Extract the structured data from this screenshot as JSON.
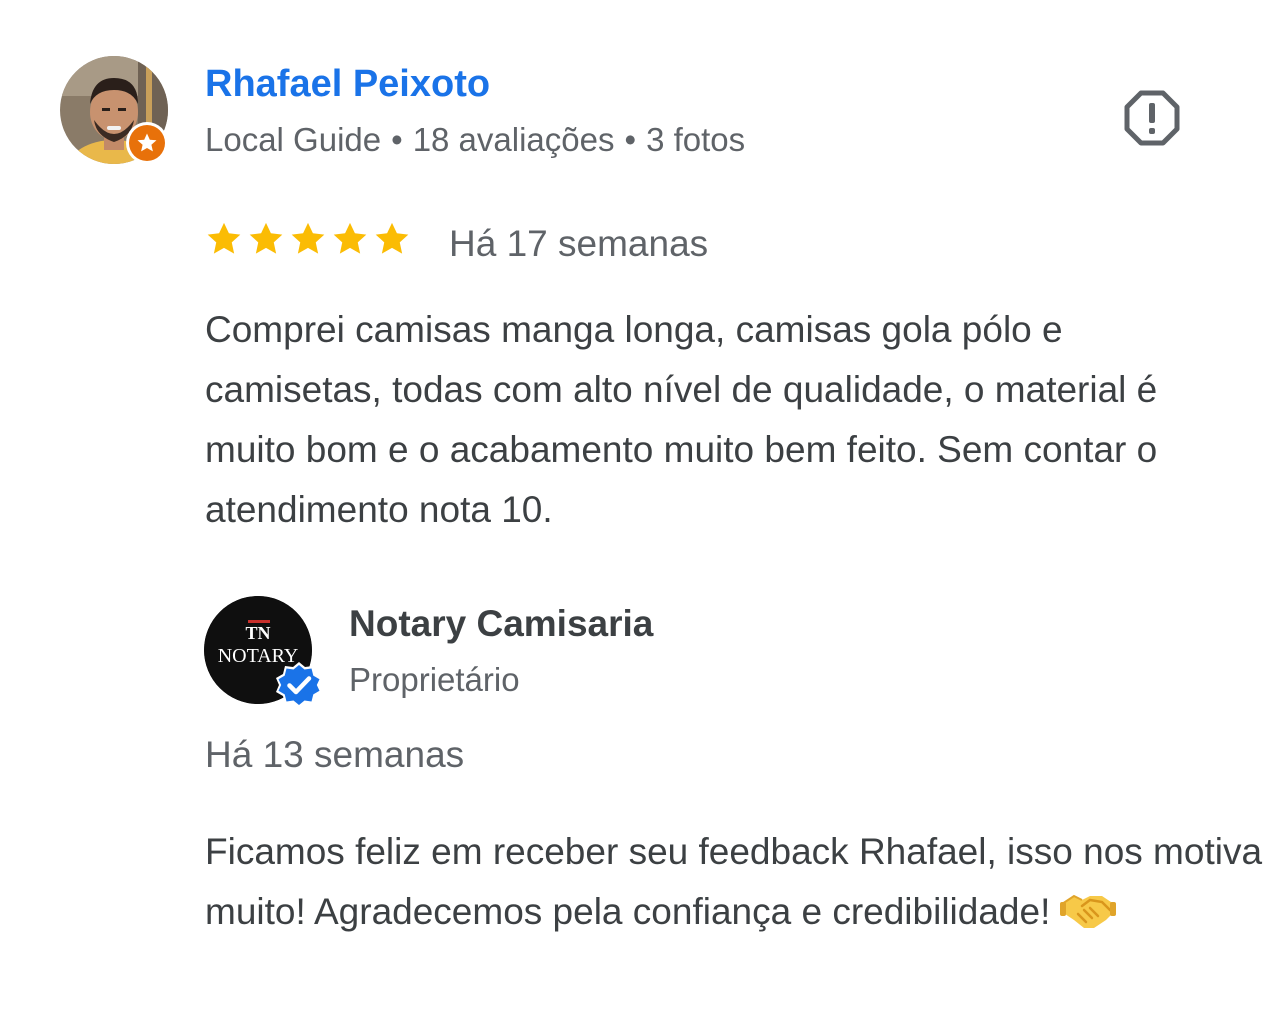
{
  "review": {
    "reviewer": {
      "name": "Rhafael Peixoto",
      "level": "Local Guide",
      "reviews_count": "18 avaliações",
      "photos_count": "3 fotos",
      "separator": "•",
      "badge_icon": "star-icon",
      "badge_color": "#e8710a"
    },
    "report_icon": "report-flag-icon",
    "rating": 5,
    "rating_max": 5,
    "star_color": "#fbbc04",
    "date": "Há 17 semanas",
    "text": "Comprei camisas manga longa, camisas gola pólo e camisetas, todas com alto nível de qualidade, o material é muito bom e o acabamento muito bem feito. Sem contar o atendimento nota 10."
  },
  "owner_response": {
    "name": "Notary Camisaria",
    "role": "Proprietário",
    "logo_text": "NOTARY",
    "logo_monogram": "TN",
    "verified_icon": "verified-check-icon",
    "verified_color": "#1a73e8",
    "date": "Há 13 semanas",
    "text": "Ficamos feliz em receber seu feedback Rhafael, isso nos motiva muito! Agradecemos pela confiança e credibilidade!",
    "emoji": "handshake-emoji"
  },
  "colors": {
    "name_link": "#1a73e8",
    "secondary_text": "#5f6368",
    "body_text": "#3c4043"
  }
}
